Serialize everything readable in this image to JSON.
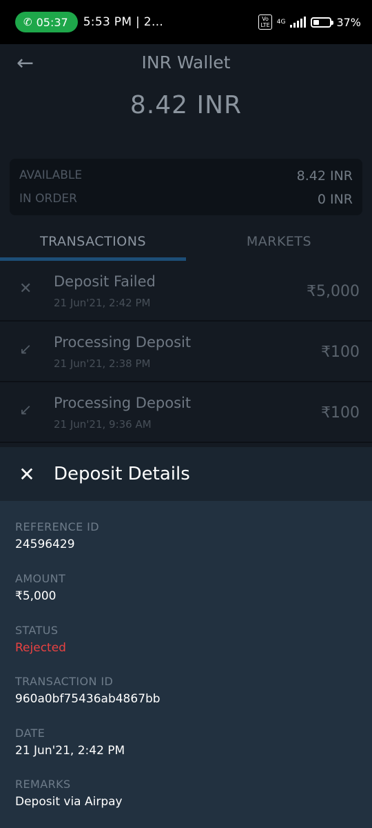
{
  "status_bar": {
    "call_time": "05:37",
    "info_text": "5:53 PM | 2…",
    "volte": "Vo LTE",
    "network": "4G",
    "battery": "37%",
    "battery_level": 0.37
  },
  "wallet": {
    "title": "INR Wallet",
    "balance": "8.42 INR",
    "available_label": "AVAILABLE",
    "available_value": "8.42 INR",
    "in_order_label": "IN ORDER",
    "in_order_value": "0 INR"
  },
  "tabs": [
    {
      "label": "TRANSACTIONS",
      "active": true
    },
    {
      "label": "MARKETS",
      "active": false
    }
  ],
  "transactions": [
    {
      "icon": "close-icon",
      "glyph": "✕",
      "label": "Deposit Failed",
      "date": "21 Jun'21, 2:42 PM",
      "amount": "₹5,000"
    },
    {
      "icon": "arrow-down-left-icon",
      "glyph": "↙",
      "label": "Processing Deposit",
      "date": "21 Jun'21, 2:38 PM",
      "amount": "₹100"
    },
    {
      "icon": "arrow-down-left-icon",
      "glyph": "↙",
      "label": "Processing Deposit",
      "date": "21 Jun'21, 9:36 AM",
      "amount": "₹100"
    }
  ],
  "deposit_details": {
    "title": "Deposit Details",
    "fields": [
      {
        "label": "REFERENCE ID",
        "value": "24596429"
      },
      {
        "label": "AMOUNT",
        "value": "₹5,000"
      },
      {
        "label": "STATUS",
        "value": "Rejected"
      },
      {
        "label": "TRANSACTION ID",
        "value": "960a0bf75436ab4867bb"
      },
      {
        "label": "DATE",
        "value": "21 Jun'21, 2:42 PM"
      },
      {
        "label": "REMARKS",
        "value": "Deposit via Airpay"
      }
    ]
  },
  "colors": {
    "call_pill": "#1ea74a",
    "status_rejected": "#e84242",
    "tab_underline": "#1d4e77",
    "sheet_bg": "#223140"
  }
}
